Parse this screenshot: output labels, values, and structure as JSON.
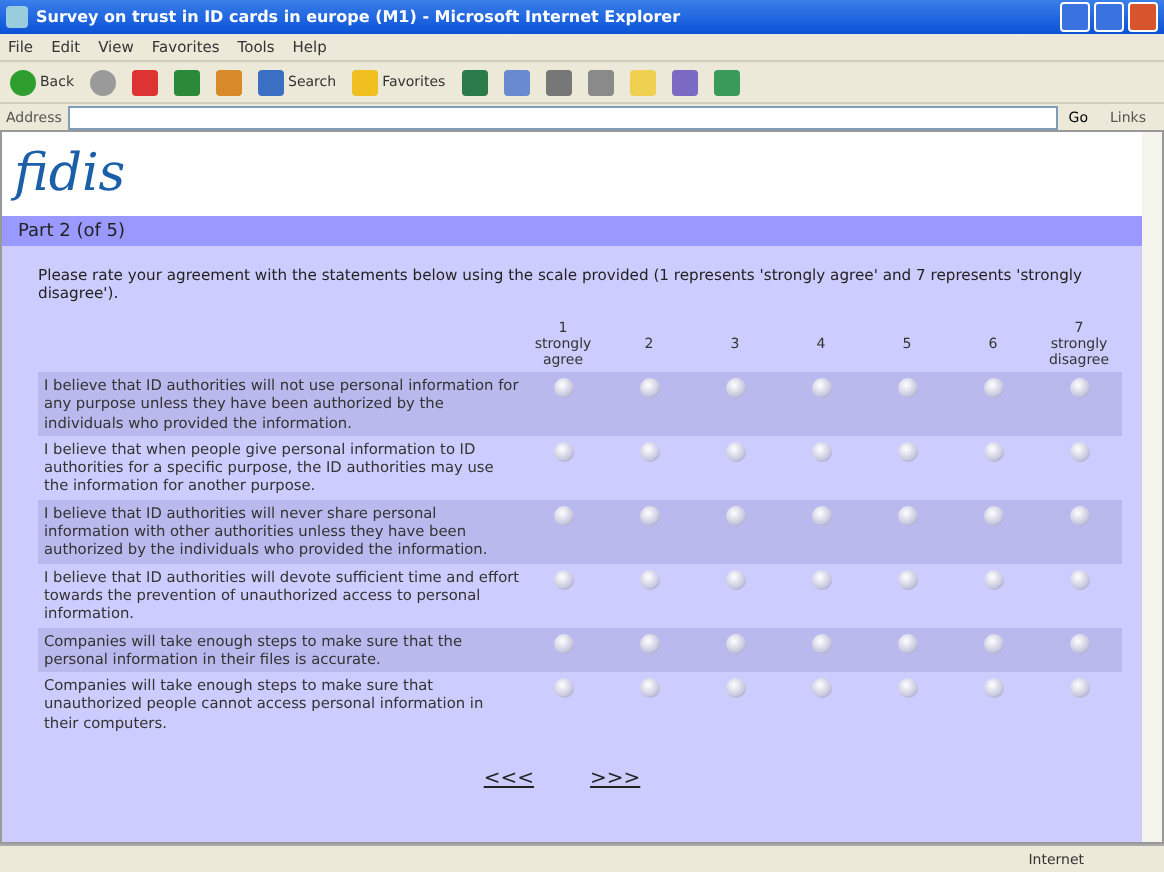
{
  "window": {
    "title": "Survey on trust in ID cards in europe (M1) - Microsoft Internet Explorer"
  },
  "menu": [
    "File",
    "Edit",
    "View",
    "Favorites",
    "Tools",
    "Help"
  ],
  "toolbar": [
    {
      "kind": "back",
      "label": "Back"
    },
    {
      "kind": "forward"
    },
    {
      "kind": "stop"
    },
    {
      "kind": "refresh"
    },
    {
      "kind": "home"
    },
    {
      "kind": "search",
      "label": "Search"
    },
    {
      "kind": "favorites",
      "label": "Favorites"
    },
    {
      "kind": "media"
    },
    {
      "kind": "mail"
    },
    {
      "kind": "print"
    },
    {
      "kind": "edit"
    },
    {
      "kind": "folder"
    },
    {
      "kind": "research"
    },
    {
      "kind": "messenger"
    }
  ],
  "address": {
    "label": "Address",
    "go": "Go",
    "links": "Links"
  },
  "logo": "fidis",
  "part_header": "Part 2 (of 5)",
  "instructions": "Please rate your agreement with the statements below using the scale provided (1 represents 'strongly agree' and 7 represents 'strongly disagree').",
  "scale": [
    {
      "value": "1",
      "label": "strongly agree"
    },
    {
      "value": "2"
    },
    {
      "value": "3"
    },
    {
      "value": "4"
    },
    {
      "value": "5"
    },
    {
      "value": "6"
    },
    {
      "value": "7",
      "label": "strongly disagree"
    }
  ],
  "statements": [
    {
      "text": "I believe that ID authorities will not use personal information for any purpose unless they have been authorized by the individuals who provided the information.",
      "choices": [
        {
          "selected": false
        },
        {
          "selected": false
        },
        {
          "selected": false
        },
        {
          "selected": false
        },
        {
          "selected": false
        },
        {
          "selected": false
        },
        {
          "selected": false
        }
      ]
    },
    {
      "text": "I believe that when people give personal information to ID authorities for a specific purpose, the ID authorities may use the information for another purpose.",
      "choices": [
        {
          "selected": false
        },
        {
          "selected": false
        },
        {
          "selected": false
        },
        {
          "selected": false
        },
        {
          "selected": false
        },
        {
          "selected": false
        },
        {
          "selected": false
        }
      ]
    },
    {
      "text": "I believe that ID authorities will never share personal information with other authorities unless they have been authorized by the individuals who provided the information.",
      "choices": [
        {
          "selected": false
        },
        {
          "selected": false
        },
        {
          "selected": false
        },
        {
          "selected": false
        },
        {
          "selected": false
        },
        {
          "selected": false
        },
        {
          "selected": false
        }
      ]
    },
    {
      "text": "I believe that ID authorities will devote sufficient time and effort towards the prevention of unauthorized access to personal information.",
      "choices": [
        {
          "selected": false
        },
        {
          "selected": false
        },
        {
          "selected": false
        },
        {
          "selected": false
        },
        {
          "selected": false
        },
        {
          "selected": false
        },
        {
          "selected": false
        }
      ]
    },
    {
      "text": "Companies will take enough steps to make sure that the personal information in their files is accurate.",
      "choices": [
        {
          "selected": false
        },
        {
          "selected": false
        },
        {
          "selected": false
        },
        {
          "selected": false
        },
        {
          "selected": false
        },
        {
          "selected": false
        },
        {
          "selected": false
        }
      ]
    },
    {
      "text": "Companies will take enough steps to make sure that unauthorized people cannot access personal information in their computers.",
      "choices": [
        {
          "selected": false
        },
        {
          "selected": false
        },
        {
          "selected": false
        },
        {
          "selected": false
        },
        {
          "selected": false
        },
        {
          "selected": false
        },
        {
          "selected": false
        }
      ]
    }
  ],
  "nav": {
    "previous": "<<<",
    "next": ">>>"
  },
  "status_bar": {
    "zone": "Internet"
  }
}
